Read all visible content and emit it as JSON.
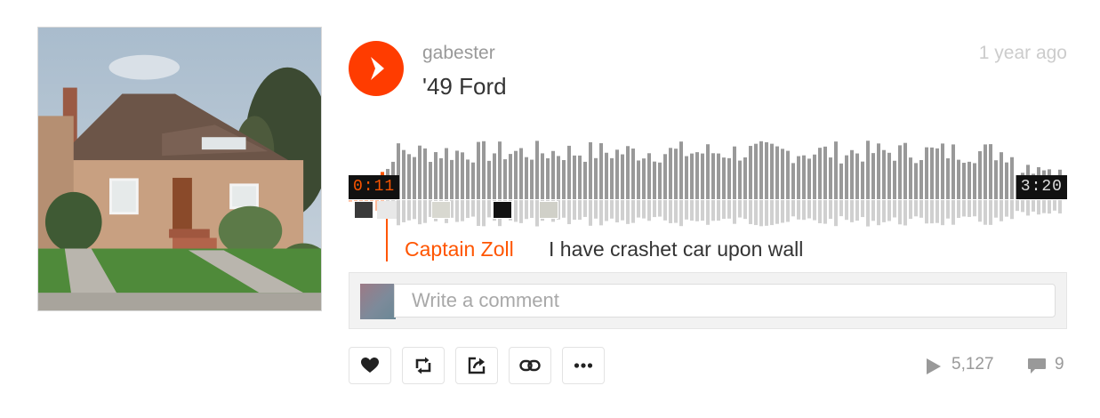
{
  "track": {
    "artwork_icon": "house-photo",
    "username": "gabester",
    "title": "'49 Ford",
    "posted": "1 year ago",
    "play_icon": "play-icon"
  },
  "player": {
    "current_time": "0:11",
    "duration": "3:20",
    "progress": 0.055,
    "accent_color": "#ff5500",
    "bar_color": "#999999"
  },
  "featured_comment": {
    "author": "Captain Zoll",
    "text": "I have crashet car upon wall"
  },
  "comment_form": {
    "placeholder": "Write a comment"
  },
  "actions": [
    {
      "icon": "heart-icon"
    },
    {
      "icon": "repost-icon"
    },
    {
      "icon": "share-icon"
    },
    {
      "icon": "link-icon"
    },
    {
      "icon": "more-icon"
    }
  ],
  "stats": {
    "plays": "5,127",
    "comments": "9"
  }
}
